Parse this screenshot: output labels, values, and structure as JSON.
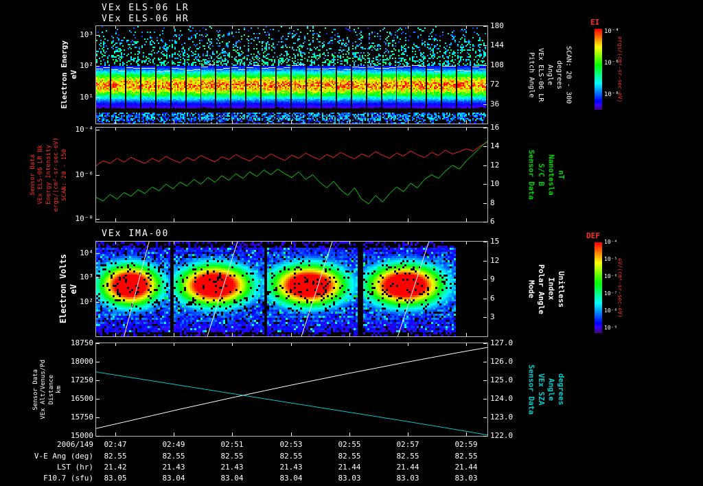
{
  "header": {
    "title1": "VEx ELS-06 LR",
    "title2": "VEx ELS-06 HR"
  },
  "colors": {
    "background": "#000000",
    "axis": "#c8c8c8",
    "red_series": "#ff2020",
    "green_series": "#00dd00",
    "white_series": "#ffffff",
    "cyan_series": "#00cccc",
    "label_red": "#ff2a2a",
    "label_green": "#00d400",
    "label_cyan": "#00cccc",
    "colorbar_title": "#ff3222"
  },
  "panel1": {
    "left_label": [
      "Electron Energy",
      "eV"
    ],
    "yticks": [
      "10³",
      "10²",
      "10¹"
    ],
    "right_ticks": [
      "180",
      "144",
      "108",
      "72",
      "36"
    ],
    "right_label": [
      "Pitch Angle",
      "VEx ELS-06 LR",
      "Angle",
      "degrees",
      "SCAN: 20 - 300"
    ]
  },
  "panel2": {
    "left_label": [
      "Sensor Data",
      "VEx ELS-06 LR Bk",
      "Energy Intensity",
      "ergs/(cm²-sr-sec-eV)",
      "SCAN: 20 - 150"
    ],
    "yticks": [
      "10⁻⁴",
      "10⁻⁶",
      "10⁻⁸"
    ],
    "right_ticks": [
      "16",
      "14",
      "12",
      "10",
      "8",
      "6"
    ],
    "right_label": [
      "Sensor Data",
      "S/C B",
      "Nanotesla",
      "nT"
    ]
  },
  "panel3": {
    "title": "VEx IMA-00",
    "left_label": [
      "Electron Volts",
      "eV"
    ],
    "yticks": [
      "10⁴",
      "10³",
      "10²"
    ],
    "right_ticks": [
      "15",
      "12",
      "9",
      "6",
      "3"
    ],
    "right_label": [
      "Mode",
      "Polar Angle",
      "Index",
      "Unitless"
    ]
  },
  "panel4": {
    "left_label": [
      "Sensor Data",
      "VEx Alt/Venus/Pd",
      "Distance",
      "km"
    ],
    "yticks": [
      "18750",
      "18000",
      "17250",
      "16500",
      "15750",
      "15000"
    ],
    "right_ticks": [
      "127.0",
      "126.0",
      "125.0",
      "124.0",
      "123.0",
      "122.0"
    ],
    "right_label": [
      "Sensor Data",
      "VEx SZA",
      "Angle",
      "degrees"
    ]
  },
  "colorbars": [
    {
      "title": "EI",
      "ticks": [
        "10⁻⁴",
        "10⁻⁶",
        "10⁻⁸"
      ],
      "unit": "ergs/(cm²-sr-sec-eV)"
    },
    {
      "title": "DEF",
      "ticks": [
        "10⁻⁴",
        "10⁻⁵",
        "10⁻⁶",
        "10⁻⁷",
        "10⁻⁸",
        "10⁻⁹"
      ],
      "unit": "eV/(cm²-sr-sec-eV)"
    }
  ],
  "time_axis": {
    "date": "2006/149",
    "labels": [
      "02:47",
      "02:49",
      "02:51",
      "02:53",
      "02:55",
      "02:57",
      "02:59"
    ]
  },
  "table": {
    "rows": [
      {
        "label": "V-E Ang (deg)",
        "values": [
          "82.55",
          "82.55",
          "82.55",
          "82.55",
          "82.55",
          "82.55",
          "82.55"
        ]
      },
      {
        "label": "LST (hr)",
        "values": [
          "21.42",
          "21.43",
          "21.43",
          "21.43",
          "21.44",
          "21.44",
          "21.44"
        ]
      },
      {
        "label": "F10.7 (sfu)",
        "values": [
          "83.05",
          "83.04",
          "83.04",
          "83.04",
          "83.03",
          "83.03",
          "83.03"
        ]
      }
    ]
  },
  "chart_data": [
    {
      "type": "heatmap",
      "name": "els_electron_spectrogram",
      "title": "VEx ELS-06 LR/HR electron energy-time spectrogram",
      "ylabel": "Electron Energy (eV)",
      "yscale": "log",
      "ylim": [
        1,
        2000
      ],
      "x_range": [
        "02:46",
        "03:00"
      ],
      "right_axis": {
        "label": "Pitch Angle (degrees)",
        "ylim": [
          0,
          180
        ],
        "ticks": [
          180,
          144,
          108,
          72,
          36
        ]
      },
      "colorbar": "EI",
      "n_energy_sweeps": 26,
      "core_band_center_frac": 0.6,
      "core_band_sigma_frac": 0.135,
      "overlay_line": {
        "name": "mean-energy-trace",
        "color": "#ffffff",
        "y_frac": 0.43
      }
    },
    {
      "type": "line",
      "name": "intensity_and_bfield",
      "series": [
        {
          "name": "VEx ELS-06 LR Bk Energy Intensity",
          "units": "ergs/(cm²-sr-sec-eV)",
          "color": "#ff2020",
          "axis": "left",
          "scale": "log10",
          "range": [
            -8,
            -4
          ],
          "values": [
            -5.62,
            -5.41,
            -5.52,
            -5.3,
            -5.47,
            -5.26,
            -5.4,
            -5.52,
            -5.31,
            -5.44,
            -5.22,
            -5.38,
            -5.49,
            -5.27,
            -5.4,
            -5.18,
            -5.33,
            -5.45,
            -5.24,
            -5.36,
            -5.14,
            -5.3,
            -5.42,
            -5.2,
            -5.33,
            -5.11,
            -5.27,
            -5.39,
            -5.17,
            -5.3,
            -5.08,
            -5.24,
            -5.36,
            -5.14,
            -5.27,
            -5.05,
            -5.21,
            -5.33,
            -5.11,
            -5.24,
            -5.02,
            -5.18,
            -5.3,
            -5.08,
            -5.21,
            -4.99,
            -5.15,
            -5.27,
            -5.05,
            -5.18,
            -4.96,
            -5.12,
            -5.02,
            -4.9,
            -5.0,
            -4.78,
            -4.62
          ]
        },
        {
          "name": "S/C B",
          "units": "nT",
          "color": "#00dd00",
          "axis": "right",
          "scale": "linear",
          "range": [
            6,
            16
          ],
          "values": [
            8.6,
            8.2,
            8.9,
            8.4,
            9.1,
            8.7,
            9.4,
            9.0,
            9.7,
            9.3,
            10.0,
            9.5,
            10.2,
            9.8,
            10.5,
            10.0,
            10.7,
            10.2,
            10.9,
            10.4,
            11.1,
            10.6,
            11.3,
            10.8,
            11.5,
            11.0,
            11.6,
            11.1,
            10.7,
            11.3,
            10.5,
            11.0,
            10.2,
            9.6,
            10.3,
            9.4,
            8.8,
            9.6,
            8.4,
            7.9,
            8.8,
            8.1,
            9.0,
            9.7,
            9.2,
            10.1,
            9.6,
            10.5,
            11.0,
            10.6,
            11.4,
            12.0,
            11.6,
            12.5,
            13.2,
            13.9,
            14.6
          ]
        }
      ]
    },
    {
      "type": "heatmap",
      "name": "ima_ion_spectrogram",
      "title": "VEx IMA-00 ion spectrogram",
      "ylabel": "Electron Volts (eV)",
      "yscale": "log",
      "ylim": [
        10,
        30000
      ],
      "right_axis": {
        "label": "Polar Angle Index (Unitless)",
        "ylim": [
          0,
          15
        ],
        "ticks": [
          15,
          12,
          9,
          6,
          3
        ]
      },
      "colorbar": "DEF",
      "blocks": [
        {
          "x0": 0.0,
          "x1": 0.188
        },
        {
          "x0": 0.198,
          "x1": 0.425
        },
        {
          "x0": 0.437,
          "x1": 0.668
        },
        {
          "x0": 0.682,
          "x1": 0.916
        }
      ],
      "blob_center_frac": 0.45,
      "overlay_line": {
        "name": "polar-angle-sweep",
        "color": "#ffffff"
      }
    },
    {
      "type": "line",
      "name": "altitude_and_sza",
      "series": [
        {
          "name": "VEx Alt/Venus/Pd Distance",
          "units": "km",
          "color": "#ffffff",
          "axis": "left",
          "scale": "linear",
          "range": [
            15000,
            18750
          ],
          "values": [
            15300,
            15560,
            15820,
            16080,
            16330,
            16580,
            16820,
            17060,
            17290,
            17520,
            17740,
            17960,
            18170,
            18380,
            18580
          ]
        },
        {
          "name": "VEx SZA Angle",
          "units": "degrees",
          "color": "#00cccc",
          "axis": "right",
          "scale": "linear",
          "range": [
            122,
            127
          ],
          "values": [
            125.45,
            125.21,
            124.97,
            124.73,
            124.49,
            124.25,
            124.01,
            123.77,
            123.53,
            123.29,
            123.05,
            122.81,
            122.56,
            122.31,
            122.05
          ]
        }
      ]
    }
  ]
}
